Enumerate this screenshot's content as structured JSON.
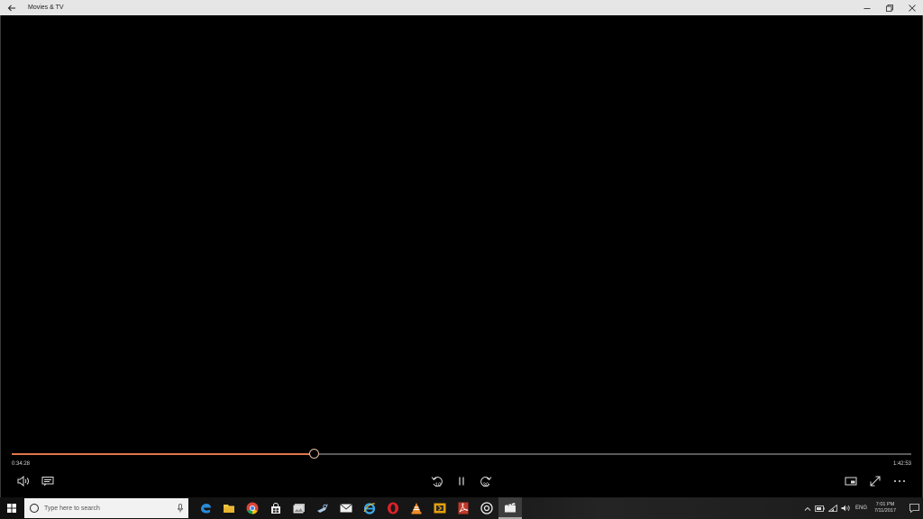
{
  "window": {
    "title": "Movies & TV"
  },
  "player": {
    "elapsed": "0:34:28",
    "total": "1:42:53",
    "progress": 0.336,
    "skip_back_seconds": "10",
    "skip_forward_seconds": "30",
    "accent_color": "#e0784a"
  },
  "taskbar": {
    "search_placeholder": "Type here to search",
    "apps": [
      "edge-icon",
      "file-explorer-icon",
      "chrome-icon",
      "store-icon",
      "photos-icon",
      "steam-icon",
      "mail-icon",
      "ie-icon",
      "opera-icon",
      "vlc-icon",
      "plex-icon",
      "acrobat-icon",
      "groove-icon",
      "movies-tv-icon"
    ],
    "language": "ENG",
    "time": "7:01 PM",
    "date": "7/11/2017"
  }
}
